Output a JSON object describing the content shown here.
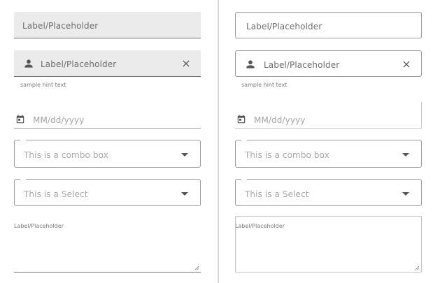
{
  "field_label": "Label/Placeholder",
  "hint_text": "sample hint text",
  "date_placeholder": "MM/dd/yyyy",
  "combo_placeholder": "This is a combo box",
  "select_placeholder": "This is a Select",
  "textarea_label": "Label/Placeholder",
  "icons": [
    "person-icon",
    "close-icon",
    "calendar-icon",
    "chevron-down-icon",
    "resize-grip-icon"
  ],
  "colors": {
    "filled_bg": "#ebebeb",
    "border": "#9c9c9c",
    "placeholder": "#a8a8a8"
  }
}
